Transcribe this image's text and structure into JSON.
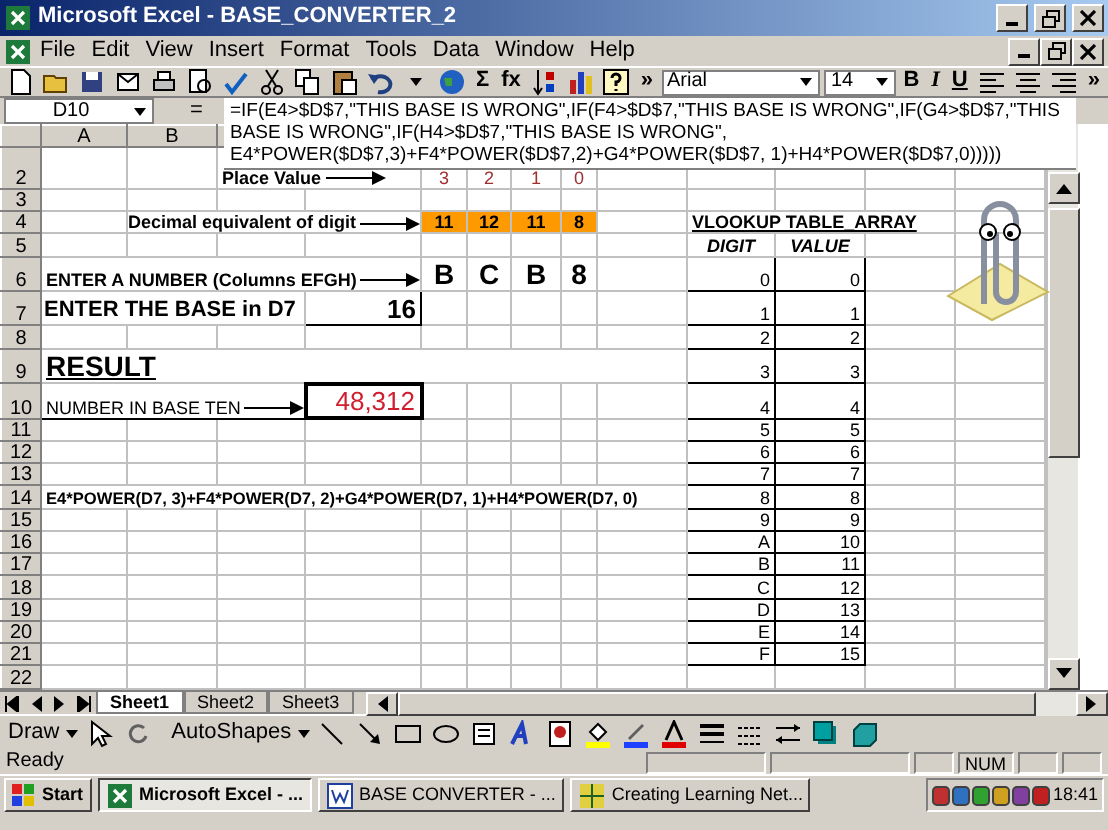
{
  "window": {
    "title": "Microsoft Excel - BASE_CONVERTER_2"
  },
  "menu": [
    "File",
    "Edit",
    "View",
    "Insert",
    "Format",
    "Tools",
    "Data",
    "Window",
    "Help"
  ],
  "toolbar": {
    "autosum": "Σ",
    "function": "fx",
    "more": "»",
    "font": "Arial",
    "size": "14",
    "bold": "B",
    "italic": "I",
    "underline": "U",
    "more_right": "»"
  },
  "formula_bar": {
    "name_box": "D10",
    "equals": "=",
    "formula": "=IF(E4>$D$7,\"THIS BASE IS WRONG\",IF(F4>$D$7,\"THIS BASE IS WRONG\",IF(G4>$D$7,\"THIS BASE IS WRONG\",IF(H4>$D$7,\"THIS BASE IS WRONG\", E4*POWER($D$7,3)+F4*POWER($D$7,2)+G4*POWER($D$7, 1)+H4*POWER($D$7,0)))))"
  },
  "column_headers": [
    "A",
    "B"
  ],
  "rows": [
    {
      "number": "2",
      "label": {
        "kind": "place-label",
        "text": "Place Value",
        "arrow": true
      },
      "place_values": [
        "3",
        "2",
        "1",
        "0"
      ]
    },
    {
      "number": "3"
    },
    {
      "number": "4",
      "label": {
        "kind": "label-right",
        "text": "Decimal equivalent of digit",
        "arrow": true
      },
      "decimal_digits": [
        "11",
        "12",
        "11",
        "8"
      ],
      "lookup_title": "VLOOKUP TABLE_ARRAY"
    },
    {
      "number": "5",
      "lookup_headers": [
        "DIGIT",
        "VALUE"
      ]
    },
    {
      "number": "6",
      "label": {
        "kind": "label",
        "text": "ENTER A NUMBER (Columns EFGH)",
        "arrow": true
      },
      "entered_digits": [
        "B",
        "C",
        "B",
        "8"
      ],
      "lookup": [
        "0",
        "0"
      ]
    },
    {
      "number": "7",
      "label": {
        "kind": "big-label",
        "text": "ENTER THE BASE in D7"
      },
      "base_input": "16",
      "lookup": [
        "1",
        "1"
      ]
    },
    {
      "number": "8",
      "lookup": [
        "2",
        "2"
      ]
    },
    {
      "number": "9",
      "label": {
        "kind": "heading",
        "text": "RESULT"
      },
      "lookup": [
        "3",
        "3"
      ]
    },
    {
      "number": "10",
      "label": {
        "kind": "boxed-label",
        "text": "NUMBER IN BASE TEN",
        "arrow": true
      },
      "result": "48,312",
      "lookup": [
        "4",
        "4"
      ]
    },
    {
      "number": "11",
      "lookup": [
        "5",
        "5"
      ]
    },
    {
      "number": "12",
      "lookup": [
        "6",
        "6"
      ]
    },
    {
      "number": "13",
      "lookup": [
        "7",
        "7"
      ]
    },
    {
      "number": "14",
      "label": {
        "kind": "formula",
        "text": "E4*POWER(D7, 3)+F4*POWER(D7, 2)+G4*POWER(D7, 1)+H4*POWER(D7, 0)"
      },
      "lookup": [
        "8",
        "8"
      ]
    },
    {
      "number": "15",
      "lookup": [
        "9",
        "9"
      ]
    },
    {
      "number": "16",
      "lookup": [
        "A",
        "10"
      ]
    },
    {
      "number": "17",
      "lookup": [
        "B",
        "11"
      ]
    },
    {
      "number": "18",
      "lookup": [
        "C",
        "12"
      ]
    },
    {
      "number": "19",
      "lookup": [
        "D",
        "13"
      ]
    },
    {
      "number": "20",
      "lookup": [
        "E",
        "14"
      ]
    },
    {
      "number": "21",
      "lookup": [
        "F",
        "15"
      ]
    },
    {
      "number": "22"
    }
  ],
  "sheet_tabs": [
    {
      "label": "Sheet1",
      "selected": true
    },
    {
      "label": "Sheet2",
      "selected": false
    },
    {
      "label": "Sheet3",
      "selected": false
    }
  ],
  "drawing_toolbar": {
    "draw": "Draw",
    "autoshapes": "AutoShapes"
  },
  "status_bar": {
    "text": "Ready",
    "num": "NUM"
  },
  "taskbar": {
    "start": "Start",
    "buttons": [
      {
        "label": "Microsoft Excel - ...",
        "selected": true
      },
      {
        "label": "BASE CONVERTER - ...",
        "selected": false
      },
      {
        "label": "Creating Learning Net...",
        "selected": false
      }
    ],
    "time": "18:41"
  }
}
